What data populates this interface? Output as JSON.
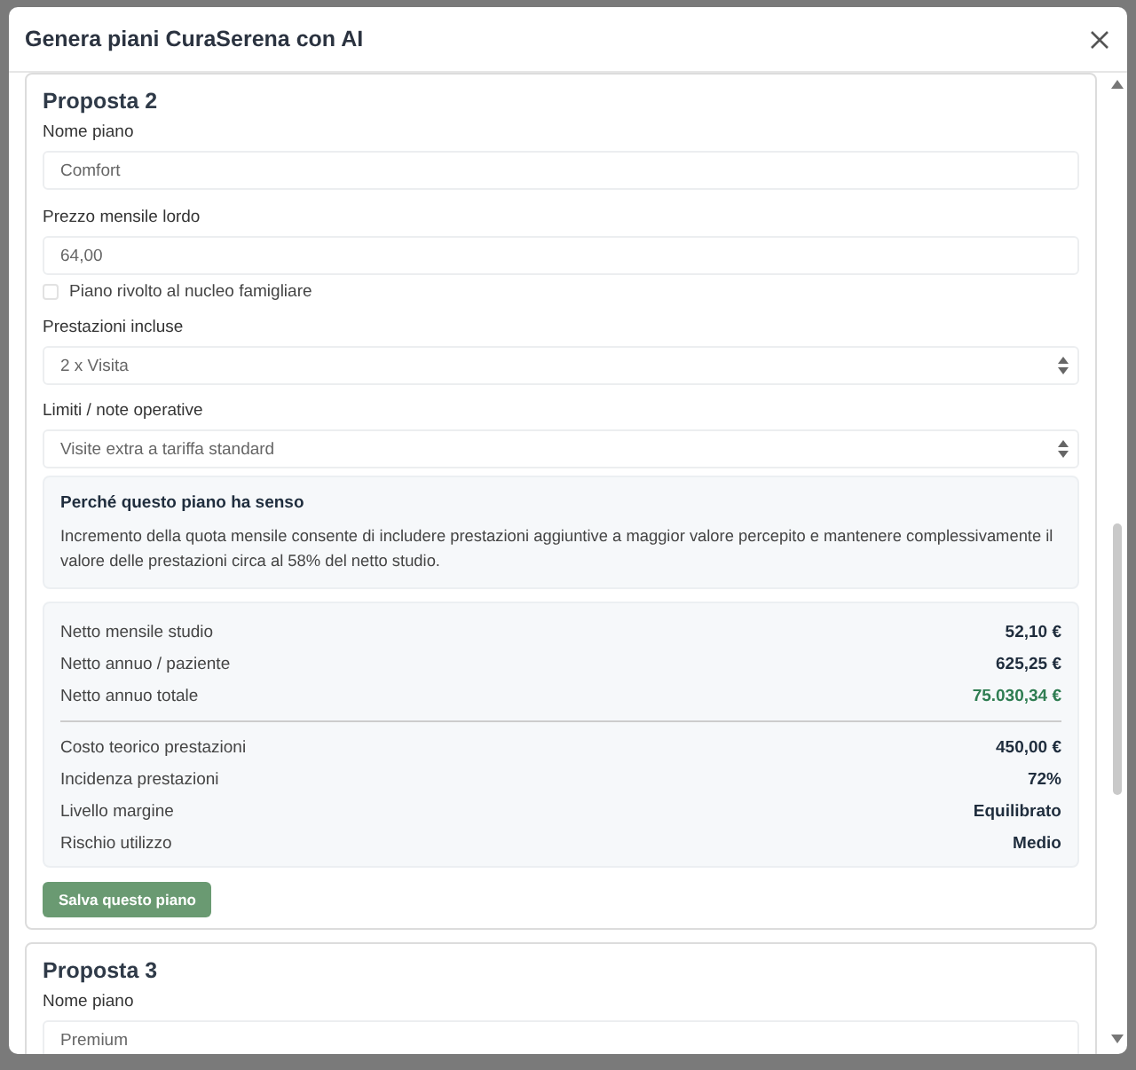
{
  "dialog": {
    "title": "Genera piani CuraSerena con AI"
  },
  "proposals": [
    {
      "title": "Proposta 2",
      "fields": [
        {
          "kind": "input",
          "label": "Nome piano",
          "value": "Comfort"
        },
        {
          "kind": "input",
          "label": "Prezzo mensile lordo",
          "value": "64,00"
        },
        {
          "kind": "checkbox",
          "label": "Piano rivolto al nucleo famigliare",
          "checked": false
        },
        {
          "kind": "textarea",
          "label": "Prestazioni incluse",
          "value": "2 x Visita"
        },
        {
          "kind": "textarea",
          "label": "Limiti / note operative",
          "value": "Visite extra a tariffa standard"
        }
      ],
      "rationale": {
        "title": "Perché questo piano ha senso",
        "text": "Incremento della quota mensile consente di includere prestazioni aggiuntive a maggior valore percepito e mantenere complessivamente il valore delle prestazioni circa al 58% del netto studio."
      },
      "stats": [
        [
          {
            "label": "Netto mensile studio",
            "value": "52,10 €",
            "highlight": false
          },
          {
            "label": "Netto annuo / paziente",
            "value": "625,25 €",
            "highlight": false
          },
          {
            "label": "Netto annuo totale",
            "value": "75.030,34 €",
            "highlight": true
          }
        ],
        [
          {
            "label": "Costo teorico prestazioni",
            "value": "450,00 €",
            "highlight": false
          },
          {
            "label": "Incidenza prestazioni",
            "value": "72%",
            "highlight": false
          },
          {
            "label": "Livello margine",
            "value": "Equilibrato",
            "highlight": false
          },
          {
            "label": "Rischio utilizzo",
            "value": "Medio",
            "highlight": false
          }
        ]
      ],
      "save_button": "Salva questo piano"
    },
    {
      "title": "Proposta 3",
      "fields": [
        {
          "kind": "input",
          "label": "Nome piano",
          "value": "Premium"
        }
      ]
    }
  ]
}
